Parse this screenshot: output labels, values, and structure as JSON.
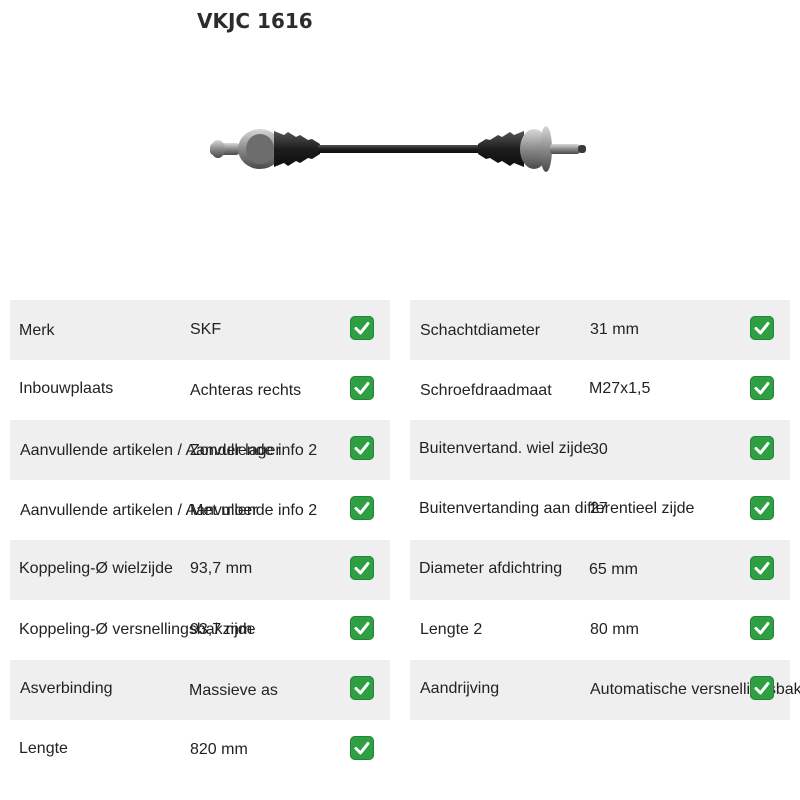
{
  "product": {
    "title": "VKJC 1616",
    "image_name": "drive-shaft-image"
  },
  "status_icon": "check-mark-icon",
  "colors": {
    "row_shade": "#efefef",
    "check_green": "#2ea043"
  },
  "specs_left": [
    {
      "label": "Merk",
      "value": "SKF"
    },
    {
      "label": "Inbouwplaats",
      "value": "Achteras rechts"
    },
    {
      "label": "Aanvullende artikelen / Aanvullende info 2",
      "value": "Zonder lager"
    },
    {
      "label": "Aanvullende artikelen / Aanvullende info 2",
      "value": "Met moer"
    },
    {
      "label": "Koppeling-Ø wielzijde",
      "value": "93,7 mm"
    },
    {
      "label": "Koppeling-Ø versnellingsbakzijde",
      "value": "93,7 mm"
    },
    {
      "label": "Asverbinding",
      "value": "Massieve as"
    },
    {
      "label": "Lengte",
      "value": "820 mm"
    }
  ],
  "specs_right": [
    {
      "label": "Schachtdiameter",
      "value": "31 mm"
    },
    {
      "label": "Schroefdraadmaat",
      "value": "M27x1,5"
    },
    {
      "label": "Buitenvertand. wiel zijde",
      "value": "30"
    },
    {
      "label": "Buitenvertanding aan differentieel zijde",
      "value": "27"
    },
    {
      "label": "Diameter afdichtring",
      "value": "65 mm"
    },
    {
      "label": "Lengte 2",
      "value": "80 mm"
    },
    {
      "label": "Aandrijving",
      "value": "Automatische versnellingsbak"
    }
  ]
}
